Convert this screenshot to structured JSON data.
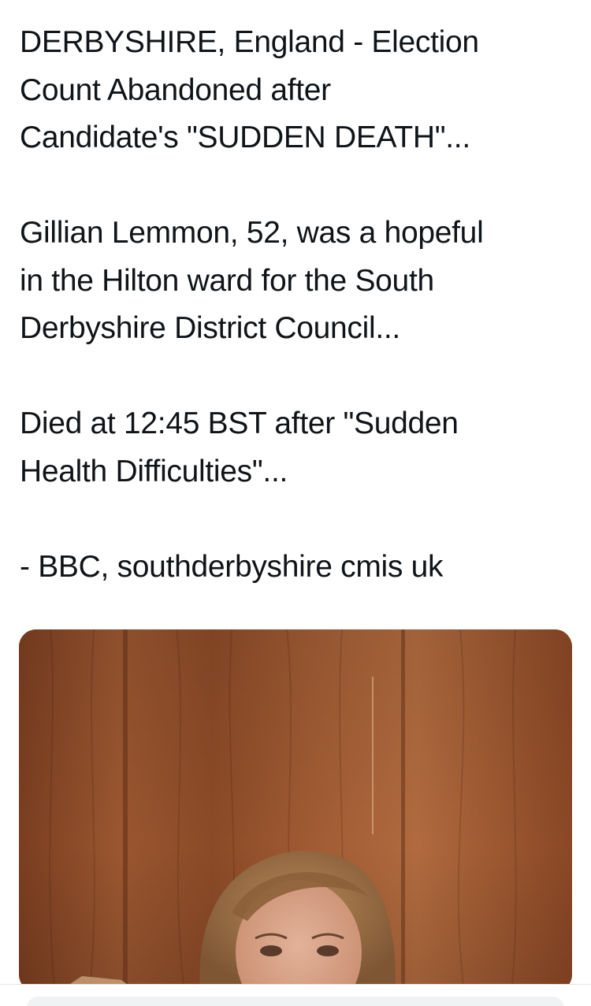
{
  "tweet": {
    "paragraphs": [
      {
        "lines": [
          "DERBYSHIRE, England - Election",
          "Count Abandoned after",
          "Candidate's \"SUDDEN DEATH\"..."
        ]
      },
      {
        "lines": [
          "Gillian Lemmon, 52, was a hopeful",
          "in the Hilton ward for the South",
          "Derbyshire District Council..."
        ]
      },
      {
        "lines": [
          "Died at 12:45 BST after \"Sudden",
          "Health Difficulties\"..."
        ]
      },
      {
        "lines": [
          "- BBC, southderbyshire cmis uk"
        ]
      }
    ]
  },
  "media": {
    "kind": "photo",
    "subject": "person-portrait",
    "colors": {
      "wood_dark": "#7a3e20",
      "wood_mid": "#9a5630",
      "wood_light": "#b06a3e",
      "hair": "#a5794f",
      "skin": "#d8a58a"
    }
  },
  "reply_bar": {
    "icon": "none"
  }
}
